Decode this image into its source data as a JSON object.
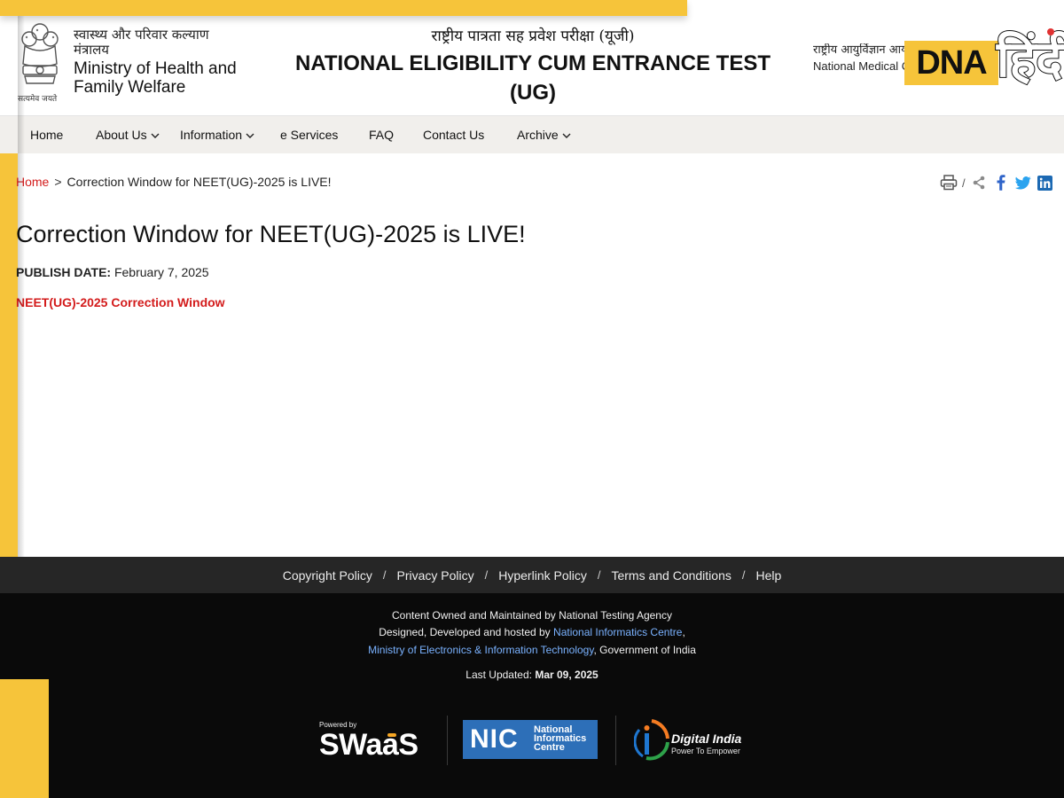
{
  "header": {
    "emblem_caption": "सत्यमेव जयते",
    "ministry_hindi": "स्वास्थ्य और परिवार कल्याण मंत्रालय",
    "ministry_english": "Ministry of Health and Family Welfare",
    "exam_hindi": "राष्ट्रीय पात्रता सह प्रवेश परीक्षा (यूजी)",
    "exam_english": "NATIONAL ELIGIBILITY CUM ENTRANCE TEST (UG)",
    "nmc_hindi": "राष्ट्रीय आयुर्विज्ञान आयोग",
    "nmc_english": "National Medical Commission"
  },
  "watermark": {
    "dna": "DNA",
    "hindi": "हिंदी"
  },
  "nav": {
    "items": [
      "Home",
      "About Us",
      "Information",
      "e Services",
      "FAQ",
      "Contact Us",
      "Archive"
    ]
  },
  "breadcrumb": {
    "home": "Home",
    "separator": ">",
    "current": "Correction Window for NEET(UG)-2025 is LIVE!"
  },
  "share": {
    "separator": "/",
    "icons": [
      "print-icon",
      "share-icon",
      "facebook-icon",
      "twitter-icon",
      "linkedin-icon"
    ]
  },
  "article": {
    "title": "Correction Window for NEET(UG)-2025 is LIVE!",
    "publish_label": "PUBLISH DATE:",
    "publish_date": "February 7, 2025",
    "link_text": "NEET(UG)-2025 Correction Window"
  },
  "footer": {
    "links": [
      "Copyright Policy",
      "Privacy Policy",
      "Hyperlink Policy",
      "Terms and Conditions",
      "Help"
    ],
    "link_separator": "/",
    "content_owned": "Content Owned and Maintained by National Testing Agency",
    "designed_prefix": "Designed, Developed and hosted by",
    "nic_link": "National Informatics Centre",
    "comma": ",",
    "meity_link": "Ministry of Electronics & Information Technology",
    "government": ", Government of India",
    "last_updated_label": "Last Updated:",
    "last_updated_value": "Mar 09, 2025"
  },
  "partners": {
    "swaas_powered": "Powered by",
    "swaas_name": "SWaaS",
    "nic_letters": "NIC",
    "nic_caption": "National Informatics Centre",
    "digital_india_name": "Digital India",
    "digital_india_tag": "Power To Empower"
  },
  "colors": {
    "accent_red": "#d31b1b",
    "frame_yellow": "#f6c43a",
    "nav_bg": "#f1efec",
    "footer_bar": "#262626",
    "footer_bg": "#0a0a0a",
    "link_blue": "#7ab2ff",
    "nic_blue": "#2d6fb8"
  }
}
